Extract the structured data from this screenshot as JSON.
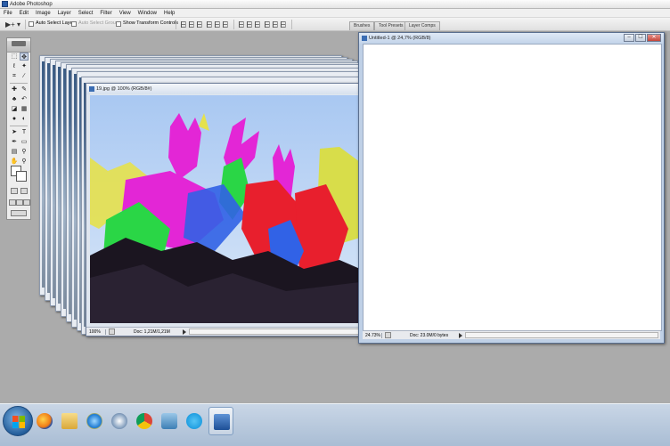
{
  "app": {
    "title": "Adobe Photoshop",
    "menu": [
      "File",
      "Edit",
      "Image",
      "Layer",
      "Select",
      "Filter",
      "View",
      "Window",
      "Help"
    ]
  },
  "options_bar": {
    "tool_glyph": "▶+ ▾",
    "auto_select_layer": "Auto Select Layer",
    "auto_select_groups": "Auto Select Groups",
    "show_transform_controls": "Show Transform Controls",
    "well_tabs": [
      "Brushes",
      "Tool Presets",
      "Layer Comps"
    ]
  },
  "documents": {
    "photo": {
      "title": "19.jpg @ 100% (RGB/8#)",
      "zoom": "100%",
      "doc_info": "Doc: 1,21M/1,21M"
    },
    "untitled": {
      "title": "Untitled-1 @ 24,7% (RGB/8)",
      "zoom": "24.73%",
      "doc_info": "Doc: 23.0M/0 bytes",
      "controls": {
        "minimize": "‒",
        "maximize": "☐",
        "close": "✕"
      }
    }
  },
  "toolbox": {
    "tools": [
      {
        "name": "marquee-tool",
        "glyph": "⬚"
      },
      {
        "name": "move-tool",
        "glyph": "✥"
      },
      {
        "name": "lasso-tool",
        "glyph": "ℓ"
      },
      {
        "name": "magic-wand-tool",
        "glyph": "✦"
      },
      {
        "name": "crop-tool",
        "glyph": "⌗"
      },
      {
        "name": "slice-tool",
        "glyph": "∕"
      },
      {
        "name": "healing-brush-tool",
        "glyph": "✚"
      },
      {
        "name": "brush-tool",
        "glyph": "✎"
      },
      {
        "name": "clone-stamp-tool",
        "glyph": "♣"
      },
      {
        "name": "history-brush-tool",
        "glyph": "↶"
      },
      {
        "name": "eraser-tool",
        "glyph": "◪"
      },
      {
        "name": "gradient-tool",
        "glyph": "▦"
      },
      {
        "name": "blur-tool",
        "glyph": "●"
      },
      {
        "name": "dodge-tool",
        "glyph": "◐"
      },
      {
        "name": "path-selection-tool",
        "glyph": "➤"
      },
      {
        "name": "type-tool",
        "glyph": "T"
      },
      {
        "name": "pen-tool",
        "glyph": "✒"
      },
      {
        "name": "shape-tool",
        "glyph": "▭"
      },
      {
        "name": "notes-tool",
        "glyph": "▤"
      },
      {
        "name": "eyedropper-tool",
        "glyph": "⚲"
      },
      {
        "name": "hand-tool",
        "glyph": "✋"
      },
      {
        "name": "zoom-tool",
        "glyph": "⚲"
      }
    ]
  },
  "taskbar": {
    "items": [
      "firefox-icon",
      "file-explorer-icon",
      "internet-explorer-icon",
      "media-player-icon",
      "chrome-icon",
      "network-icon",
      "skype-icon",
      "photoshop-icon"
    ]
  },
  "colors": {
    "desktop": "#ababab",
    "photo_magenta": "#e326d6",
    "photo_green": "#2ad646",
    "photo_red": "#e81f2d",
    "photo_yellow": "#d8dd4a",
    "photo_blue": "#3162e6"
  }
}
